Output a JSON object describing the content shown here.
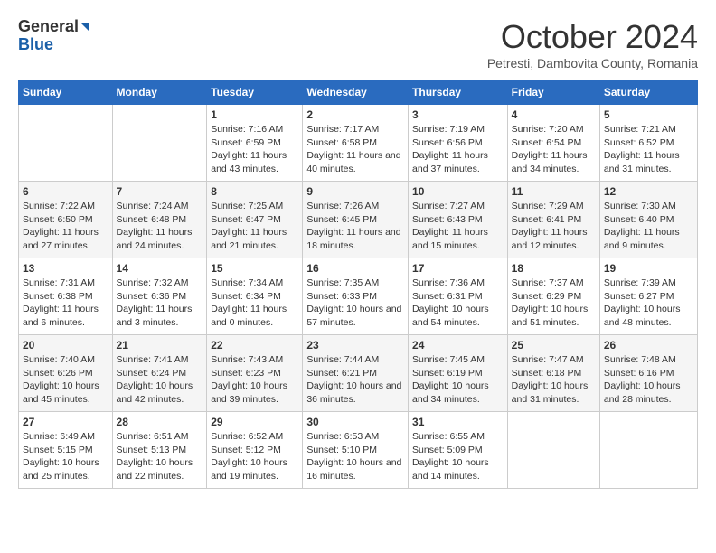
{
  "header": {
    "logo_general": "General",
    "logo_blue": "Blue",
    "month_title": "October 2024",
    "location": "Petresti, Dambovita County, Romania"
  },
  "days_of_week": [
    "Sunday",
    "Monday",
    "Tuesday",
    "Wednesday",
    "Thursday",
    "Friday",
    "Saturday"
  ],
  "weeks": [
    [
      {
        "day": "",
        "content": ""
      },
      {
        "day": "",
        "content": ""
      },
      {
        "day": "1",
        "content": "Sunrise: 7:16 AM\nSunset: 6:59 PM\nDaylight: 11 hours and 43 minutes."
      },
      {
        "day": "2",
        "content": "Sunrise: 7:17 AM\nSunset: 6:58 PM\nDaylight: 11 hours and 40 minutes."
      },
      {
        "day": "3",
        "content": "Sunrise: 7:19 AM\nSunset: 6:56 PM\nDaylight: 11 hours and 37 minutes."
      },
      {
        "day": "4",
        "content": "Sunrise: 7:20 AM\nSunset: 6:54 PM\nDaylight: 11 hours and 34 minutes."
      },
      {
        "day": "5",
        "content": "Sunrise: 7:21 AM\nSunset: 6:52 PM\nDaylight: 11 hours and 31 minutes."
      }
    ],
    [
      {
        "day": "6",
        "content": "Sunrise: 7:22 AM\nSunset: 6:50 PM\nDaylight: 11 hours and 27 minutes."
      },
      {
        "day": "7",
        "content": "Sunrise: 7:24 AM\nSunset: 6:48 PM\nDaylight: 11 hours and 24 minutes."
      },
      {
        "day": "8",
        "content": "Sunrise: 7:25 AM\nSunset: 6:47 PM\nDaylight: 11 hours and 21 minutes."
      },
      {
        "day": "9",
        "content": "Sunrise: 7:26 AM\nSunset: 6:45 PM\nDaylight: 11 hours and 18 minutes."
      },
      {
        "day": "10",
        "content": "Sunrise: 7:27 AM\nSunset: 6:43 PM\nDaylight: 11 hours and 15 minutes."
      },
      {
        "day": "11",
        "content": "Sunrise: 7:29 AM\nSunset: 6:41 PM\nDaylight: 11 hours and 12 minutes."
      },
      {
        "day": "12",
        "content": "Sunrise: 7:30 AM\nSunset: 6:40 PM\nDaylight: 11 hours and 9 minutes."
      }
    ],
    [
      {
        "day": "13",
        "content": "Sunrise: 7:31 AM\nSunset: 6:38 PM\nDaylight: 11 hours and 6 minutes."
      },
      {
        "day": "14",
        "content": "Sunrise: 7:32 AM\nSunset: 6:36 PM\nDaylight: 11 hours and 3 minutes."
      },
      {
        "day": "15",
        "content": "Sunrise: 7:34 AM\nSunset: 6:34 PM\nDaylight: 11 hours and 0 minutes."
      },
      {
        "day": "16",
        "content": "Sunrise: 7:35 AM\nSunset: 6:33 PM\nDaylight: 10 hours and 57 minutes."
      },
      {
        "day": "17",
        "content": "Sunrise: 7:36 AM\nSunset: 6:31 PM\nDaylight: 10 hours and 54 minutes."
      },
      {
        "day": "18",
        "content": "Sunrise: 7:37 AM\nSunset: 6:29 PM\nDaylight: 10 hours and 51 minutes."
      },
      {
        "day": "19",
        "content": "Sunrise: 7:39 AM\nSunset: 6:27 PM\nDaylight: 10 hours and 48 minutes."
      }
    ],
    [
      {
        "day": "20",
        "content": "Sunrise: 7:40 AM\nSunset: 6:26 PM\nDaylight: 10 hours and 45 minutes."
      },
      {
        "day": "21",
        "content": "Sunrise: 7:41 AM\nSunset: 6:24 PM\nDaylight: 10 hours and 42 minutes."
      },
      {
        "day": "22",
        "content": "Sunrise: 7:43 AM\nSunset: 6:23 PM\nDaylight: 10 hours and 39 minutes."
      },
      {
        "day": "23",
        "content": "Sunrise: 7:44 AM\nSunset: 6:21 PM\nDaylight: 10 hours and 36 minutes."
      },
      {
        "day": "24",
        "content": "Sunrise: 7:45 AM\nSunset: 6:19 PM\nDaylight: 10 hours and 34 minutes."
      },
      {
        "day": "25",
        "content": "Sunrise: 7:47 AM\nSunset: 6:18 PM\nDaylight: 10 hours and 31 minutes."
      },
      {
        "day": "26",
        "content": "Sunrise: 7:48 AM\nSunset: 6:16 PM\nDaylight: 10 hours and 28 minutes."
      }
    ],
    [
      {
        "day": "27",
        "content": "Sunrise: 6:49 AM\nSunset: 5:15 PM\nDaylight: 10 hours and 25 minutes."
      },
      {
        "day": "28",
        "content": "Sunrise: 6:51 AM\nSunset: 5:13 PM\nDaylight: 10 hours and 22 minutes."
      },
      {
        "day": "29",
        "content": "Sunrise: 6:52 AM\nSunset: 5:12 PM\nDaylight: 10 hours and 19 minutes."
      },
      {
        "day": "30",
        "content": "Sunrise: 6:53 AM\nSunset: 5:10 PM\nDaylight: 10 hours and 16 minutes."
      },
      {
        "day": "31",
        "content": "Sunrise: 6:55 AM\nSunset: 5:09 PM\nDaylight: 10 hours and 14 minutes."
      },
      {
        "day": "",
        "content": ""
      },
      {
        "day": "",
        "content": ""
      }
    ]
  ]
}
